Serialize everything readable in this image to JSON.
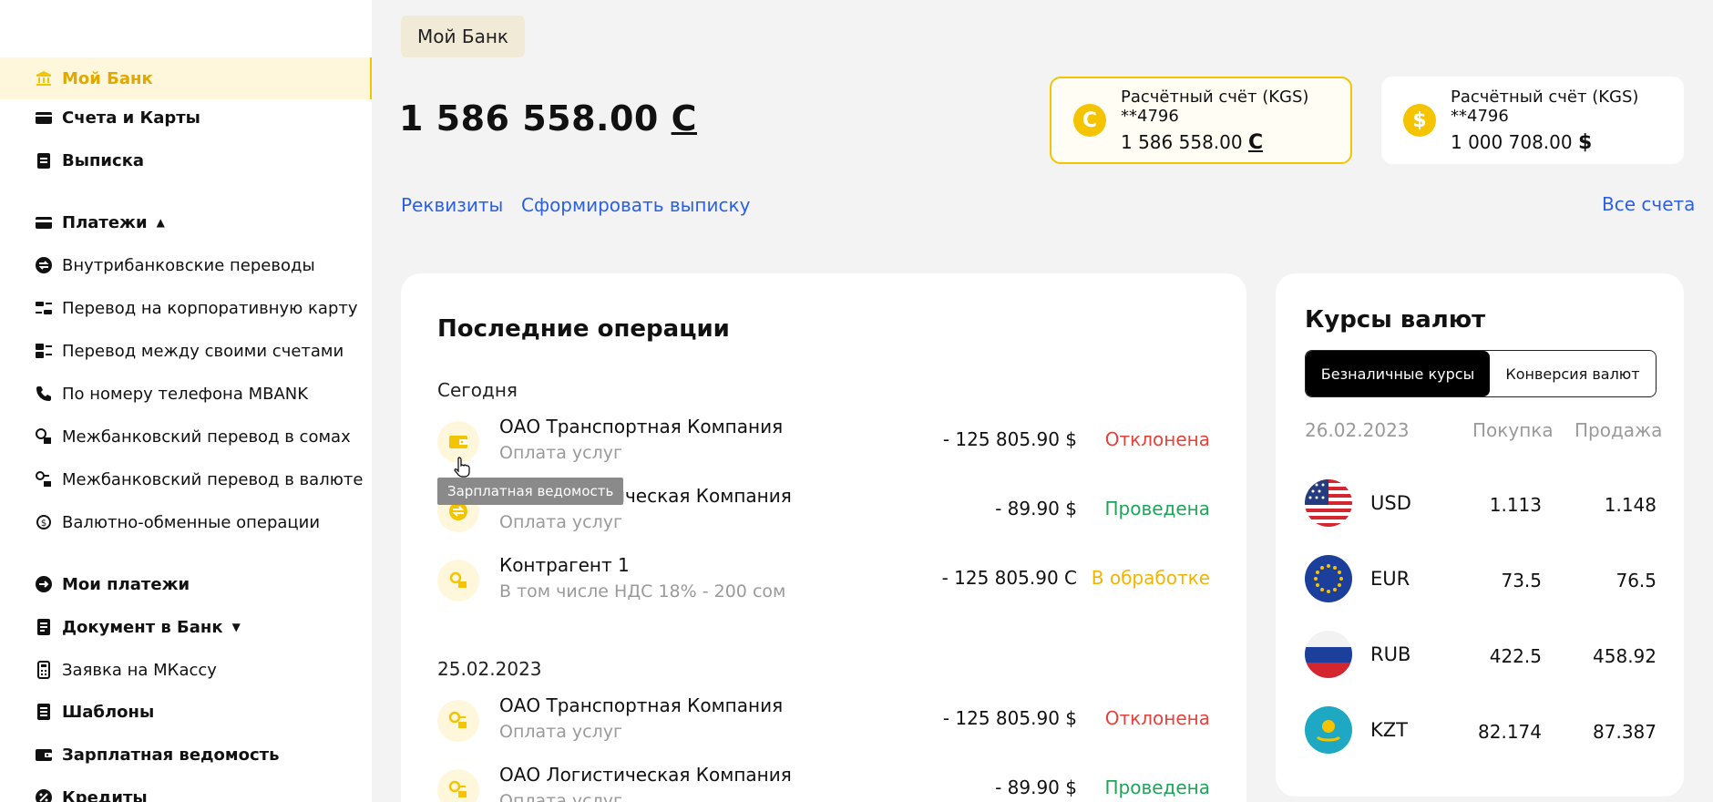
{
  "sidebar": {
    "items": [
      {
        "label": "Мой Банк",
        "icon": "bank-icon"
      },
      {
        "label": "Счета и Карты",
        "icon": "cards-icon"
      },
      {
        "label": "Выписка",
        "icon": "clipboard-icon"
      },
      {
        "label": "Платежи",
        "icon": "card-icon"
      },
      {
        "label": "Внутрибанковские переводы",
        "icon": "transfer-icon"
      },
      {
        "label": "Перевод на корпоративную карту",
        "icon": "corp-card-icon"
      },
      {
        "label": "Перевод между своими счетами",
        "icon": "own-accounts-icon"
      },
      {
        "label": "По номеру телефона MBANK",
        "icon": "phone-icon"
      },
      {
        "label": "Межбанковский перевод в сомах",
        "icon": "interbank-som-icon"
      },
      {
        "label": "Межбанковский перевод в валюте",
        "icon": "interbank-currency-icon"
      },
      {
        "label": "Валютно-обменные операции",
        "icon": "exchange-icon"
      },
      {
        "label": "Мои платежи",
        "icon": "arrow-circle-icon"
      },
      {
        "label": "Документ в Банк",
        "icon": "document-icon"
      },
      {
        "label": "Заявка на МКассу",
        "icon": "terminal-icon"
      },
      {
        "label": "Шаблоны",
        "icon": "template-icon"
      },
      {
        "label": "Зарплатная ведомость",
        "icon": "wallet-icon"
      },
      {
        "label": "Кредиты",
        "icon": "percent-icon"
      }
    ]
  },
  "header": {
    "breadcrumb": "Мой Банк",
    "balance": "1 586 558.00",
    "balance_currency": "С",
    "links": {
      "requisites": "Реквизиты",
      "statement": "Сформировать выписку",
      "all_accounts": "Все счета"
    }
  },
  "accounts": [
    {
      "title": "Расчётный счёт (KGS) **4796",
      "amount": "1 586 558.00",
      "currency": "С",
      "coin": "С",
      "selected": true
    },
    {
      "title": "Расчётный счёт (KGS) **4796",
      "amount": "1 000 708.00",
      "currency": "$",
      "coin": "$",
      "selected": false
    }
  ],
  "operations": {
    "title": "Последние операции",
    "tooltip": "Зарплатная ведомость",
    "groups": [
      {
        "date": "Сегодня",
        "rows": [
          {
            "name": "ОАО Транспортная Компания",
            "desc": "Оплата услуг",
            "amount": "- 125 805.90 $",
            "status": "Отклонена",
            "status_color": "#e5423b",
            "icon": "wallet-icon"
          },
          {
            "name": "ОАО Логистическая Компания",
            "desc": "Оплата услуг",
            "amount": "- 89.90 $",
            "status": "Проведена",
            "status_color": "#1ea55a",
            "icon": "transfer-icon"
          },
          {
            "name": "Контрагент 1",
            "desc": "В том числе НДС 18% - 200 сом",
            "amount": "- 125 805.90 С",
            "status": "В обработке",
            "status_color": "#f3b400",
            "icon": "interbank-som-icon"
          }
        ]
      },
      {
        "date": "25.02.2023",
        "rows": [
          {
            "name": "ОАО Транспортная Компания",
            "desc": "Оплата услуг",
            "amount": "- 125 805.90 $",
            "status": "Отклонена",
            "status_color": "#e5423b",
            "icon": "interbank-currency-icon"
          },
          {
            "name": "ОАО Логистическая Компания",
            "desc": "Оплата услуг",
            "amount": "- 89.90 $",
            "status": "Проведена",
            "status_color": "#1ea55a",
            "icon": "interbank-currency-icon"
          }
        ]
      }
    ]
  },
  "rates": {
    "title": "Курсы валют",
    "tabs": [
      "Безналичные курсы",
      "Конверсия валют"
    ],
    "date": "26.02.2023",
    "buy_label": "Покупка",
    "sell_label": "Продажа",
    "rows": [
      {
        "code": "USD",
        "buy": "1.113",
        "sell": "1.148",
        "flag": "usa-flag-icon"
      },
      {
        "code": "EUR",
        "buy": "73.5",
        "sell": "76.5",
        "flag": "eu-flag-icon"
      },
      {
        "code": "RUB",
        "buy": "422.5",
        "sell": "458.92",
        "flag": "russia-flag-icon"
      },
      {
        "code": "KZT",
        "buy": "82.174",
        "sell": "87.387",
        "flag": "kazakhstan-flag-icon"
      }
    ]
  },
  "colors": {
    "accent": "#f3c400",
    "link": "#2b60e4",
    "rejected": "#e5423b",
    "done": "#1ea55a",
    "processing": "#f3b400"
  }
}
